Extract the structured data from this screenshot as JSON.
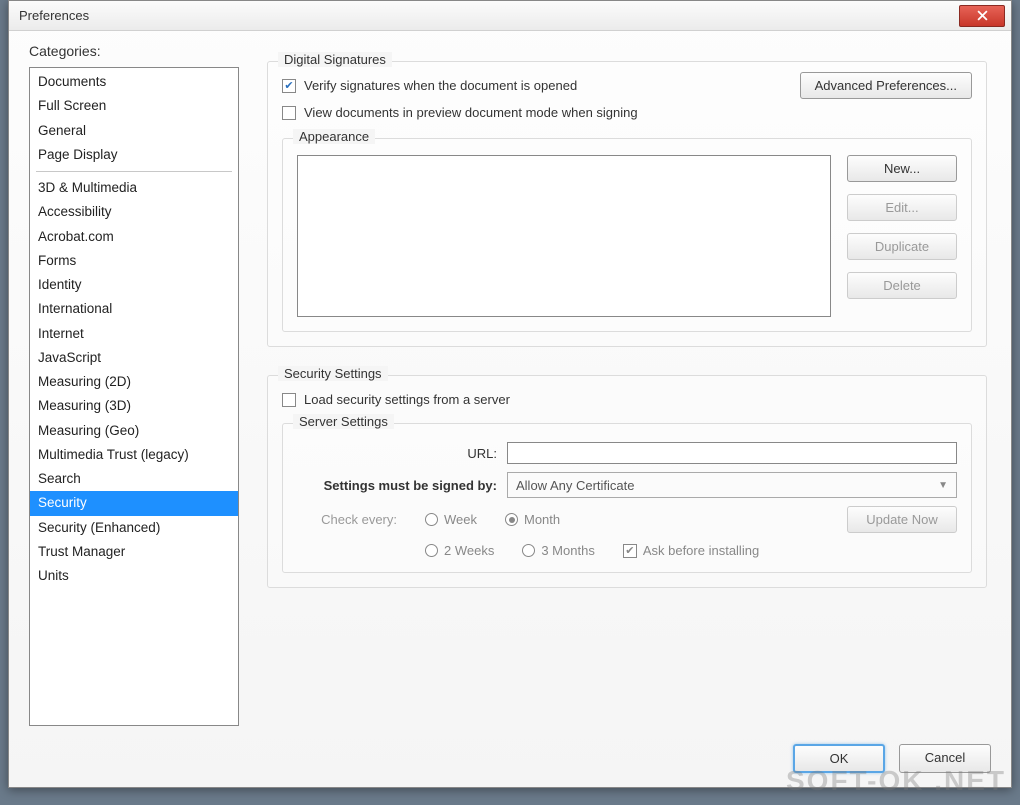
{
  "window": {
    "title": "Preferences"
  },
  "sidebar": {
    "label": "Categories:",
    "group1": [
      "Documents",
      "Full Screen",
      "General",
      "Page Display"
    ],
    "group2": [
      "3D & Multimedia",
      "Accessibility",
      "Acrobat.com",
      "Forms",
      "Identity",
      "International",
      "Internet",
      "JavaScript",
      "Measuring (2D)",
      "Measuring (3D)",
      "Measuring (Geo)",
      "Multimedia Trust (legacy)",
      "Search",
      "Security",
      "Security (Enhanced)",
      "Trust Manager",
      "Units"
    ],
    "selected": "Security"
  },
  "digital": {
    "legend": "Digital Signatures",
    "verify_label": "Verify signatures when the document is opened",
    "view_label": "View documents in preview document mode when signing",
    "advanced_btn": "Advanced Preferences...",
    "appearance_legend": "Appearance",
    "btn_new": "New...",
    "btn_edit": "Edit...",
    "btn_dup": "Duplicate",
    "btn_del": "Delete"
  },
  "security": {
    "legend": "Security Settings",
    "load_label": "Load security settings from a server",
    "server_legend": "Server Settings",
    "url_label": "URL:",
    "signed_label": "Settings must be signed by:",
    "signed_value": "Allow Any Certificate",
    "check_label": "Check every:",
    "opt_week": "Week",
    "opt_month": "Month",
    "opt_2weeks": "2 Weeks",
    "opt_3months": "3 Months",
    "ask_label": "Ask before installing",
    "update_btn": "Update Now"
  },
  "footer": {
    "ok": "OK",
    "cancel": "Cancel"
  },
  "watermark": "SOFT-OK .NET"
}
